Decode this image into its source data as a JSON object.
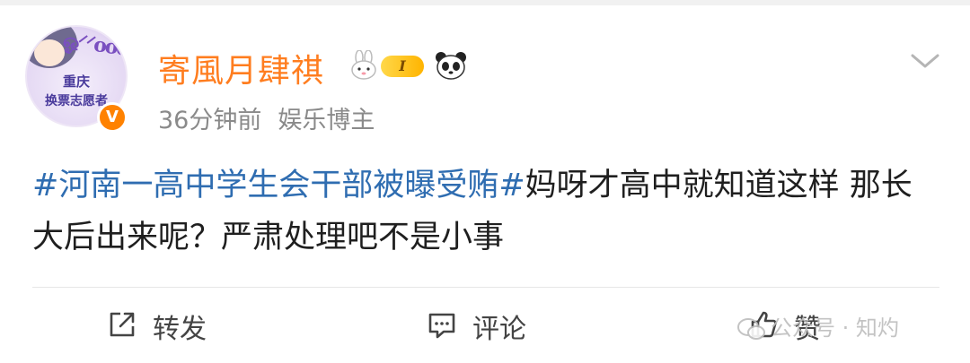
{
  "user": {
    "name": "寄風月肆祺",
    "level": "I",
    "avatar_tag_line1": "重庆",
    "avatar_tag_line2": "换票志愿者",
    "avatar_deco": "ஓ⸍⸍ooo",
    "verified_mark": "V"
  },
  "meta": {
    "time": "36分钟前",
    "role": "娱乐博主"
  },
  "post": {
    "topic": "#河南一高中学生会干部被曝受贿#",
    "text": "妈呀才高中就知道这样 那长大后出来呢？严肃处理吧不是小事"
  },
  "actions": {
    "share": "转发",
    "comment": "评论",
    "like": "赞"
  },
  "watermark": "公众号 · 知灼",
  "colors": {
    "username": "#ff7d1f",
    "topic": "#2f6db1",
    "verified": "#ff8200"
  }
}
